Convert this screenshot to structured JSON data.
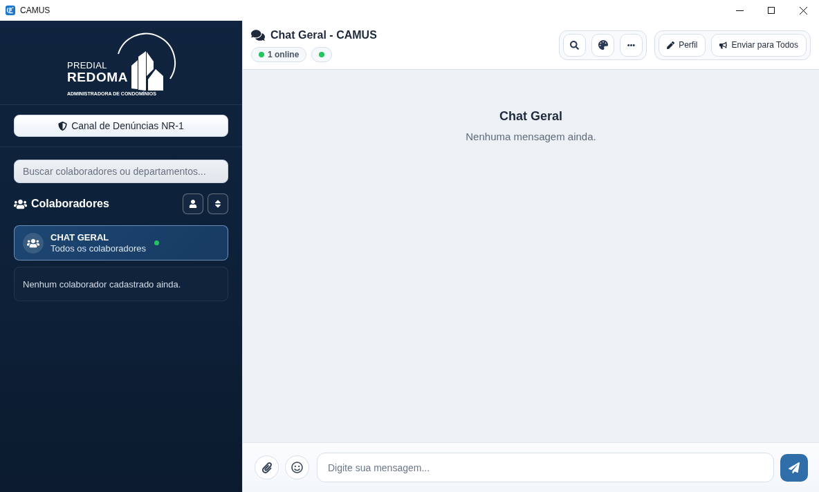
{
  "window": {
    "title": "CAMUS"
  },
  "sidebar": {
    "logo": {
      "line_1": "PREDIAL",
      "line_2": "REDOMA",
      "tagline": "ADMINISTRADORA DE CONDOMÍNIOS"
    },
    "report_button": "Canal de Denúncias NR-1",
    "search": {
      "placeholder": "Buscar colaboradores ou departamentos..."
    },
    "section_title": "Colaboradores",
    "channels": [
      {
        "name": "CHAT GERAL",
        "subtitle": "Todos os colaboradores",
        "selected": true,
        "online": true
      }
    ],
    "empty_message": "Nenhum colaborador cadastrado ainda."
  },
  "header": {
    "title": "Chat Geral - CAMUS",
    "online_count": "1 online",
    "connected": true,
    "actions": [
      "Perfil",
      "Enviar para Todos"
    ]
  },
  "chat": {
    "title": "Chat Geral",
    "empty_message": "Nenhuma mensagem ainda."
  },
  "composer": {
    "placeholder": "Digite sua mensagem..."
  }
}
